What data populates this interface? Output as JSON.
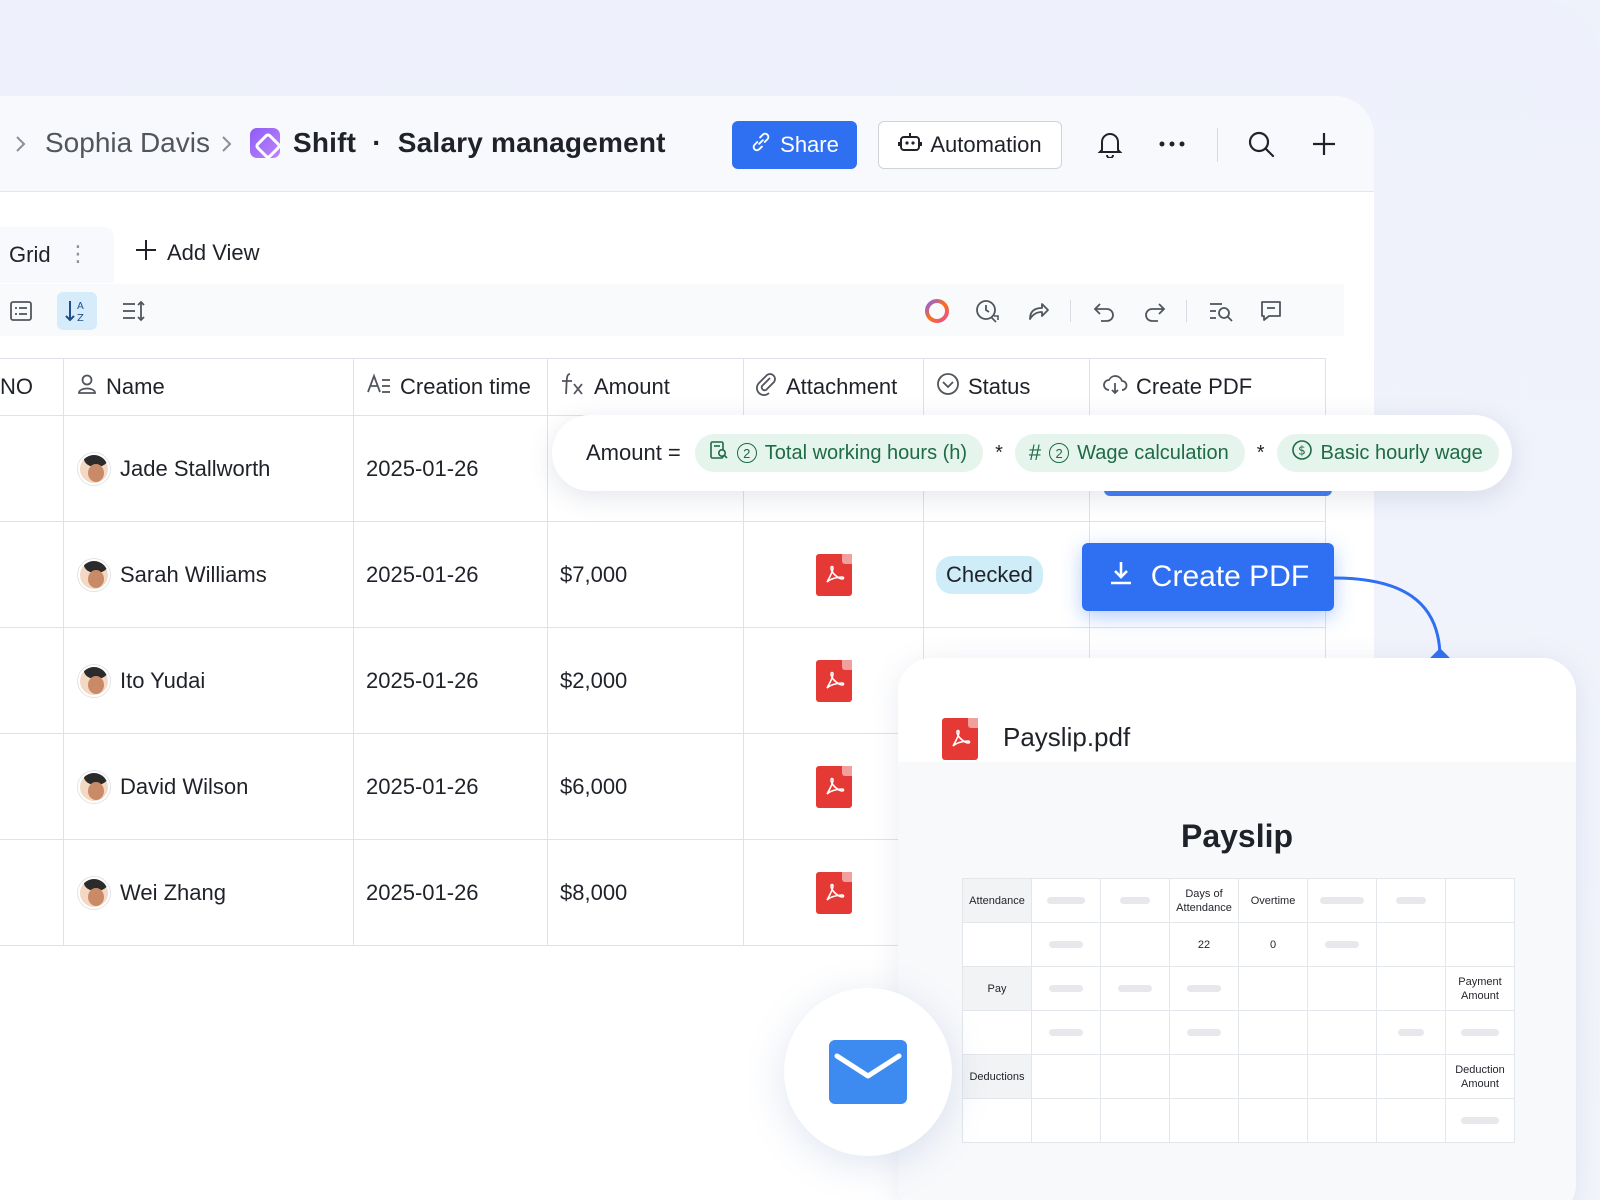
{
  "breadcrumb": {
    "user": "Sophia Davis",
    "title_app": "Shift",
    "title_sep": "·",
    "title_page": "Salary management"
  },
  "header": {
    "share_label": "Share",
    "automation_label": "Automation"
  },
  "views": {
    "active_tab": "Grid",
    "add_view_label": "Add View"
  },
  "table": {
    "columns": [
      "NO",
      "Name",
      "Creation time",
      "Amount",
      "Attachment",
      "Status",
      "Create PDF"
    ],
    "rows": [
      {
        "name": "Jade Stallworth",
        "created": "2025-01-26",
        "amount": "",
        "status": ""
      },
      {
        "name": "Sarah Williams",
        "created": "2025-01-26",
        "amount": "$7,000",
        "status": "Checked"
      },
      {
        "name": "Ito Yudai",
        "created": "2025-01-26",
        "amount": "$2,000",
        "status": ""
      },
      {
        "name": "David Wilson",
        "created": "2025-01-26",
        "amount": "$6,000",
        "status": ""
      },
      {
        "name": "Wei Zhang",
        "created": "2025-01-26",
        "amount": "$8,000",
        "status": ""
      }
    ]
  },
  "formula": {
    "label": "Amount =",
    "op": "*",
    "chips": [
      {
        "num": "2",
        "label": "Total working hours (h)"
      },
      {
        "num": "2",
        "label": "Wage calculation"
      },
      {
        "num": "",
        "label": "Basic hourly wage"
      }
    ]
  },
  "create_pdf_label": "Create PDF",
  "payslip": {
    "file_name": "Payslip.pdf",
    "title": "Payslip",
    "labels": {
      "attendance": "Attendance",
      "days_of_attendance": "Days of Attendance",
      "overtime": "Overtime",
      "days_value": "22",
      "overtime_value": "0",
      "pay": "Pay",
      "payment_amount": "Payment Amount",
      "deductions": "Deductions",
      "deduction_amount": "Deduction Amount"
    }
  },
  "colors": {
    "primary": "#2f6ff2",
    "chip_bg": "#e5f4ec",
    "chip_text": "#1f6b45",
    "status_checked_bg": "#cfedf8",
    "pdf_red": "#e53935"
  },
  "icons": [
    "chevron-right-icon",
    "app-logo-icon",
    "link-icon",
    "robot-icon",
    "bell-icon",
    "more-icon",
    "search-icon",
    "plus-icon",
    "list-icon",
    "sort-icon",
    "row-height-icon",
    "ai-ring-icon",
    "history-icon",
    "share-icon",
    "undo-icon",
    "redo-icon",
    "find-icon",
    "comment-icon",
    "pdf-icon",
    "download-icon",
    "mail-icon"
  ]
}
